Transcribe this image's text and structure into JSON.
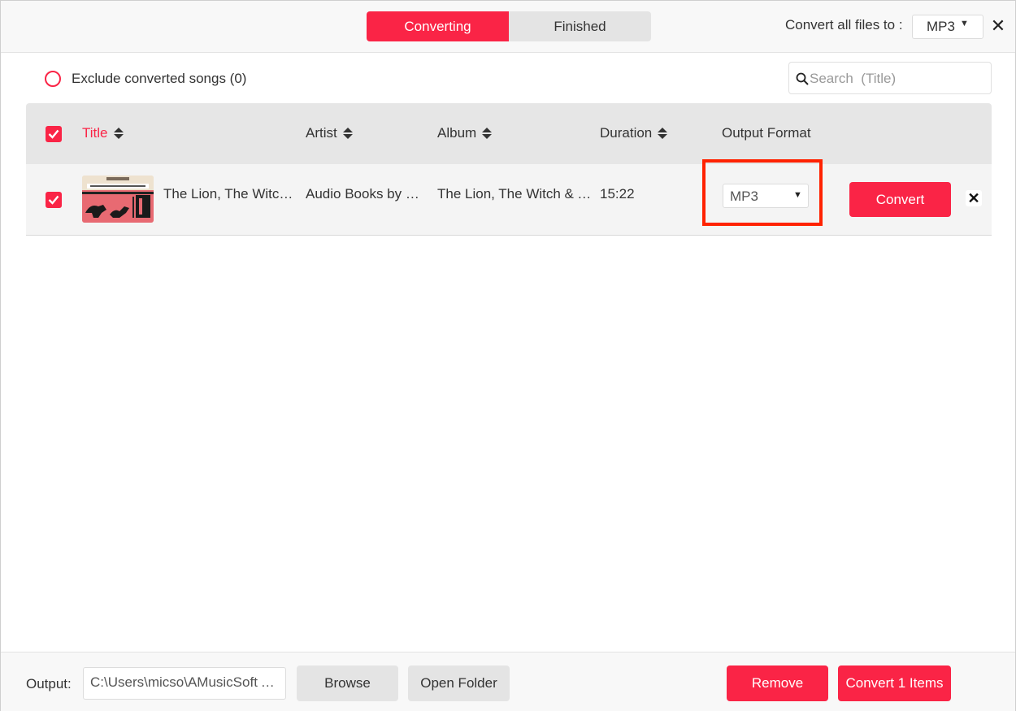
{
  "tabs": {
    "converting": "Converting",
    "finished": "Finished"
  },
  "header": {
    "convert_all_label": "Convert all files to :",
    "format": "MP3"
  },
  "filter": {
    "exclude_label": "Exclude converted songs (0)",
    "search_placeholder": "Search  (Title)"
  },
  "table": {
    "columns": {
      "title": "Title",
      "artist": "Artist",
      "album": "Album",
      "duration": "Duration",
      "output_format": "Output Format"
    },
    "rows": [
      {
        "title": "The Lion, The Witch & The Wardrobe",
        "artist": "Audio Books by C.S. Lewis",
        "album": "The Lion, The Witch & The Wardrobe",
        "duration": "15:22",
        "format": "MP3",
        "convert_label": "Convert",
        "remove_glyph": "✕"
      }
    ]
  },
  "footer": {
    "output_label": "Output:",
    "output_path": "C:\\Users\\micso\\AMusicSoft Apple Music Converter",
    "browse": "Browse",
    "open_folder": "Open Folder",
    "remove": "Remove",
    "convert_items": "Convert 1 Items"
  },
  "icons": {
    "close": "✕",
    "caret": "▼"
  },
  "colors": {
    "accent": "#fa2446",
    "highlight": "#ff2200"
  }
}
